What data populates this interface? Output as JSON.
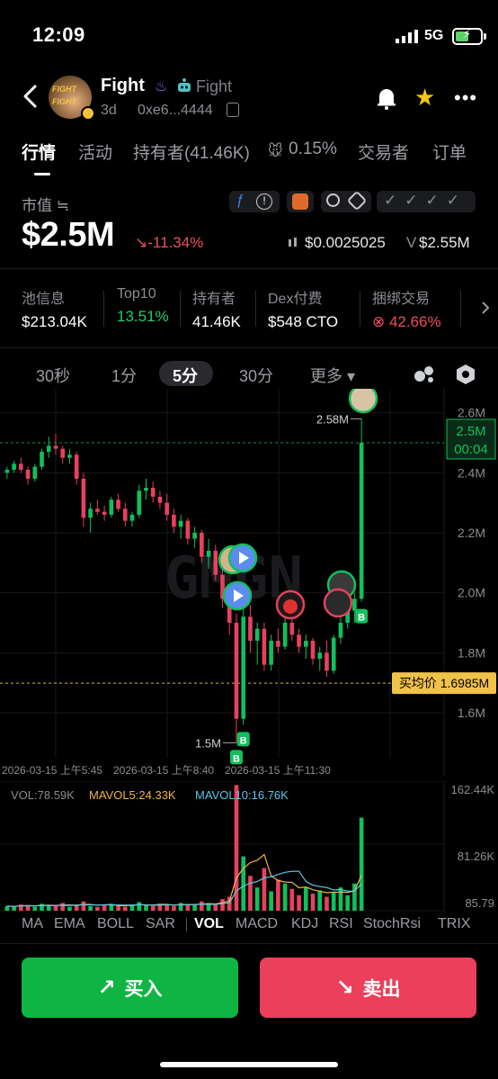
{
  "status": {
    "time": "12:09",
    "network": "5G"
  },
  "token": {
    "name": "Fight",
    "tag": "Fight",
    "age": "3d",
    "address": "0xe6...4444",
    "avatar_text": [
      "FIGHT",
      "FIGHT"
    ]
  },
  "tabs": [
    "行情",
    "活动",
    "持有者(41.46K)",
    "0.15%",
    "交易者",
    "订单"
  ],
  "market": {
    "label": "市值 ≒",
    "cap": "$2.5M",
    "change": "↘-11.34%",
    "price": "$0.0025025",
    "volume_prefix": "V",
    "volume": "$2.55M"
  },
  "stats": [
    {
      "label": "池信息",
      "value": "$213.04K",
      "color": "#ffffff"
    },
    {
      "label": "Top10",
      "value": "13.51%",
      "color": "#1fcf6a"
    },
    {
      "label": "持有者",
      "value": "41.46K",
      "color": "#ffffff"
    },
    {
      "label": "Dex付费",
      "value": "$548 CTO",
      "color": "#ffffff"
    },
    {
      "label": "捆绑交易",
      "value": "⊗ 42.66%",
      "color": "#ec4e62"
    }
  ],
  "periods": [
    "30秒",
    "1分",
    "5分",
    "30分",
    "更多 ▾"
  ],
  "active_period": "5分",
  "chart": {
    "y_labels": [
      "2.6M",
      "2.4M",
      "2.2M",
      "2.0M",
      "1.8M",
      "1.6M"
    ],
    "current_price": "2.5M",
    "countdown": "00:04",
    "avg_buy_label": "买均价 1.6985M",
    "high_label": "2.58M",
    "low_label": "1.5M",
    "watermark": "GMGN",
    "dates": [
      "2026-03-15 上午5:45",
      "2026-03-15 上午8:40",
      "2026-03-15 上午11:30"
    ],
    "vol_label": "VOL:78.59K",
    "mavol5_label": "MAVOL5:24.33K",
    "mavol10_label": "MAVOL10:16.76K",
    "vol_axis": [
      "162.44K",
      "81.26K",
      "85.79"
    ],
    "buy_marker": "B"
  },
  "chart_data": {
    "type": "candlestick",
    "title": "",
    "y_unit": "market cap",
    "ylim": [
      1.45,
      2.68
    ],
    "candles": [
      [
        2.4,
        2.42,
        2.38,
        2.41
      ],
      [
        2.41,
        2.44,
        2.4,
        2.43
      ],
      [
        2.43,
        2.45,
        2.4,
        2.41
      ],
      [
        2.41,
        2.42,
        2.36,
        2.38
      ],
      [
        2.38,
        2.43,
        2.37,
        2.42
      ],
      [
        2.42,
        2.48,
        2.41,
        2.47
      ],
      [
        2.47,
        2.52,
        2.45,
        2.49
      ],
      [
        2.49,
        2.53,
        2.46,
        2.48
      ],
      [
        2.48,
        2.49,
        2.43,
        2.45
      ],
      [
        2.45,
        2.48,
        2.43,
        2.46
      ],
      [
        2.46,
        2.47,
        2.36,
        2.38
      ],
      [
        2.38,
        2.4,
        2.22,
        2.25
      ],
      [
        2.25,
        2.3,
        2.2,
        2.28
      ],
      [
        2.28,
        2.31,
        2.26,
        2.27
      ],
      [
        2.27,
        2.29,
        2.24,
        2.26
      ],
      [
        2.26,
        2.32,
        2.25,
        2.31
      ],
      [
        2.31,
        2.33,
        2.27,
        2.28
      ],
      [
        2.28,
        2.3,
        2.22,
        2.24
      ],
      [
        2.24,
        2.27,
        2.22,
        2.26
      ],
      [
        2.26,
        2.36,
        2.25,
        2.34
      ],
      [
        2.34,
        2.38,
        2.31,
        2.35
      ],
      [
        2.35,
        2.37,
        2.3,
        2.32
      ],
      [
        2.32,
        2.34,
        2.28,
        2.3
      ],
      [
        2.3,
        2.33,
        2.24,
        2.26
      ],
      [
        2.26,
        2.28,
        2.2,
        2.22
      ],
      [
        2.22,
        2.26,
        2.18,
        2.24
      ],
      [
        2.24,
        2.25,
        2.16,
        2.18
      ],
      [
        2.18,
        2.22,
        2.15,
        2.2
      ],
      [
        2.2,
        2.21,
        2.1,
        2.12
      ],
      [
        2.12,
        2.18,
        2.08,
        2.14
      ],
      [
        2.14,
        2.16,
        2.04,
        2.06
      ],
      [
        2.06,
        2.1,
        1.95,
        1.98
      ],
      [
        1.98,
        2.02,
        1.86,
        1.9
      ],
      [
        1.9,
        1.93,
        1.5,
        1.58
      ],
      [
        1.58,
        1.98,
        1.56,
        1.92
      ],
      [
        1.92,
        1.96,
        1.8,
        1.84
      ],
      [
        1.84,
        1.9,
        1.76,
        1.88
      ],
      [
        1.88,
        1.9,
        1.74,
        1.76
      ],
      [
        1.76,
        1.86,
        1.74,
        1.84
      ],
      [
        1.84,
        1.88,
        1.8,
        1.82
      ],
      [
        1.82,
        1.92,
        1.81,
        1.9
      ],
      [
        1.9,
        1.94,
        1.84,
        1.86
      ],
      [
        1.86,
        1.88,
        1.8,
        1.82
      ],
      [
        1.82,
        1.86,
        1.78,
        1.84
      ],
      [
        1.84,
        1.85,
        1.76,
        1.78
      ],
      [
        1.78,
        1.82,
        1.74,
        1.8
      ],
      [
        1.8,
        1.84,
        1.72,
        1.74
      ],
      [
        1.74,
        1.86,
        1.73,
        1.85
      ],
      [
        1.85,
        1.92,
        1.83,
        1.9
      ],
      [
        1.9,
        1.96,
        1.88,
        1.94
      ],
      [
        1.94,
        2.0,
        1.9,
        1.98
      ],
      [
        1.98,
        2.58,
        1.97,
        2.5
      ]
    ],
    "annotations": {
      "high": "2.58M",
      "low": "1.5M",
      "avg_buy": "1.6985M",
      "current": "2.5M"
    },
    "volume": [
      6,
      5,
      8,
      7,
      5,
      9,
      7,
      6,
      10,
      5,
      8,
      12,
      6,
      5,
      7,
      9,
      6,
      5,
      8,
      11,
      7,
      6,
      9,
      8,
      6,
      10,
      7,
      8,
      12,
      9,
      8,
      15,
      18,
      162,
      70,
      45,
      30,
      55,
      25,
      40,
      35,
      28,
      20,
      30,
      22,
      26,
      18,
      24,
      30,
      20,
      35,
      120
    ],
    "vol_ylim": [
      0,
      162.44
    ]
  },
  "indicators": [
    "MA",
    "EMA",
    "BOLL",
    "SAR",
    "VOL",
    "MACD",
    "KDJ",
    "RSI",
    "StochRsi",
    "TRIX"
  ],
  "active_indicator": "VOL",
  "actions": {
    "buy": "买入",
    "sell": "卖出",
    "buy_icon": "↗",
    "sell_icon": "↘"
  },
  "colors": {
    "up": "#10c05a",
    "down": "#e7415c",
    "accent_gold": "#f5c518",
    "avg_line": "#e0b23a"
  }
}
